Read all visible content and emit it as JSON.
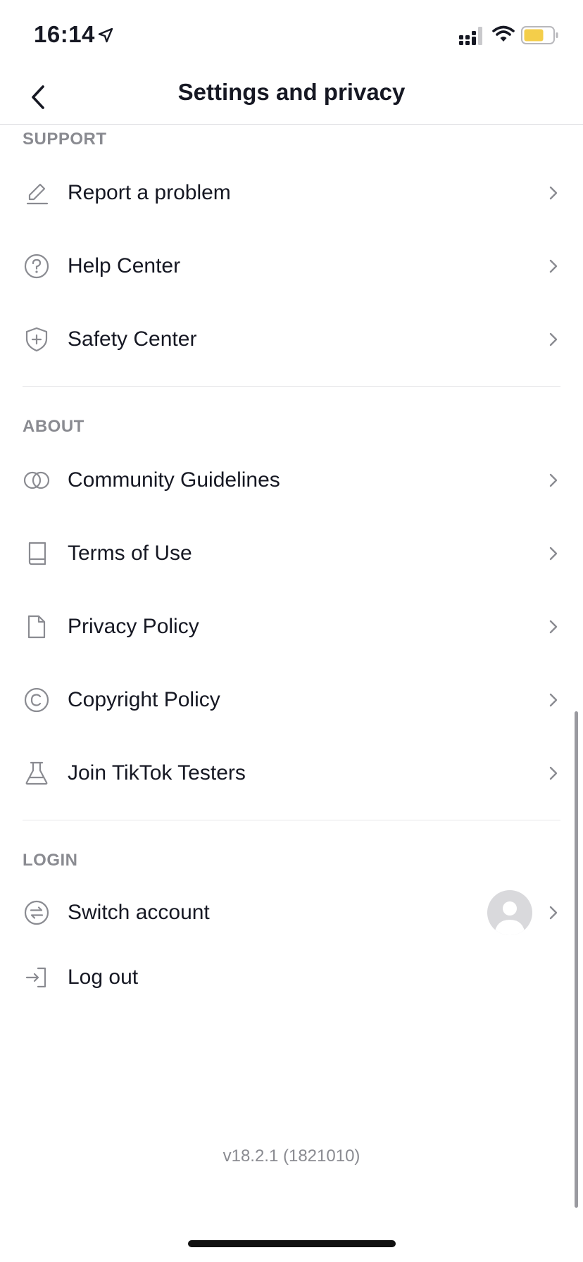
{
  "status_bar": {
    "time": "16:14",
    "icons": [
      "location-arrow-icon",
      "signal-icon",
      "wifi-icon",
      "battery-icon"
    ],
    "battery_color": "#f4ce4a"
  },
  "header": {
    "title": "Settings and privacy",
    "back_icon": "chevron-left-icon"
  },
  "sections": {
    "support": {
      "title": "SUPPORT",
      "items": [
        {
          "label": "Report a problem",
          "icon": "pencil-icon"
        },
        {
          "label": "Help Center",
          "icon": "question-circle-icon"
        },
        {
          "label": "Safety Center",
          "icon": "shield-plus-icon"
        }
      ]
    },
    "about": {
      "title": "ABOUT",
      "items": [
        {
          "label": "Community Guidelines",
          "icon": "double-circle-icon"
        },
        {
          "label": "Terms of Use",
          "icon": "book-icon"
        },
        {
          "label": "Privacy Policy",
          "icon": "document-icon"
        },
        {
          "label": "Copyright Policy",
          "icon": "copyright-icon"
        },
        {
          "label": "Join TikTok Testers",
          "icon": "flask-icon"
        }
      ]
    },
    "login": {
      "title": "LOGIN",
      "items": [
        {
          "label": "Switch account",
          "icon": "switch-arrows-icon"
        },
        {
          "label": "Log out",
          "icon": "logout-icon"
        }
      ]
    }
  },
  "version": "v18.2.1 (1821010)"
}
